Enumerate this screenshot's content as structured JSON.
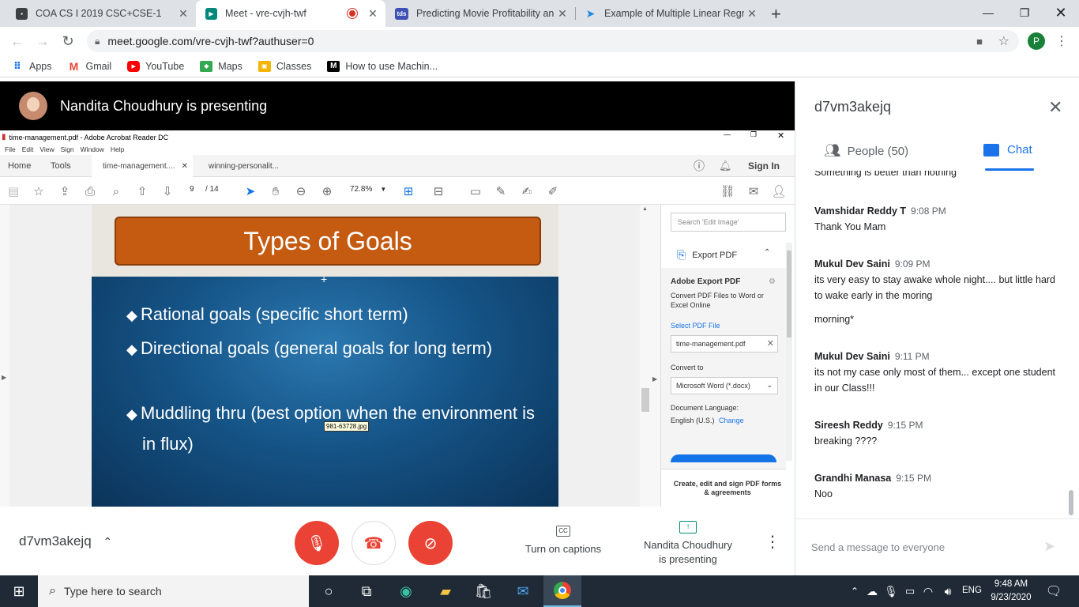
{
  "browser": {
    "tabs": [
      {
        "title": "COA CS I 2019 CSC+CSE-1",
        "color": "#202124"
      },
      {
        "title": "Meet - vre-cvjh-twf",
        "color": "#00897b"
      },
      {
        "title": "Predicting Movie Profitability and",
        "color": "#3f51b5"
      },
      {
        "title": "Example of Multiple Linear Regre",
        "color": "#1e88e5"
      }
    ],
    "tab_favicon_text": "tds",
    "new_tab": "+",
    "url": "meet.google.com/vre-cvjh-twf?authuser=0",
    "profile_initial": "P",
    "bookmarks": [
      "Apps",
      "Gmail",
      "YouTube",
      "Maps",
      "Classes",
      "How to use Machin..."
    ]
  },
  "meet": {
    "presenter_banner": "Nandita Choudhury is presenting",
    "meeting_code": "d7vm3akejq",
    "captions_label": "Turn on captions",
    "presenting_label_line1": "Nandita Choudhury",
    "presenting_label_line2": "is presenting",
    "panel_title": "d7vm3akejq",
    "people_tab": "People (50)",
    "chat_tab": "Chat",
    "partial_top_message": "Something is better than nothing",
    "messages": [
      {
        "sender": "Vamshidar Reddy T",
        "time": "9:08 PM",
        "lines": [
          "Thank You Mam"
        ]
      },
      {
        "sender": "Mukul Dev Saini",
        "time": "9:09 PM",
        "lines": [
          "its very easy to stay awake whole night.... but little hard to wake early in the moring",
          "morning*"
        ]
      },
      {
        "sender": "Mukul Dev Saini",
        "time": "9:11 PM",
        "lines": [
          "its not my case only most of them... except one student in our Class!!!"
        ]
      },
      {
        "sender": "Sireesh Reddy",
        "time": "9:15 PM",
        "lines": [
          "breaking ????"
        ]
      },
      {
        "sender": "Grandhi Manasa",
        "time": "9:15 PM",
        "lines": [
          "Noo"
        ]
      }
    ],
    "chat_placeholder": "Send a message to everyone"
  },
  "acrobat": {
    "window_title": "time-management.pdf - Adobe Acrobat Reader DC",
    "menu": [
      "File",
      "Edit",
      "View",
      "Sign",
      "Window",
      "Help"
    ],
    "tabs": [
      "Home",
      "Tools",
      "time-management....",
      "winning-personalit..."
    ],
    "sign_in": "Sign In",
    "page_current": "9",
    "page_total": "/ 14",
    "zoom": "72.8%",
    "slide": {
      "title": "Types of Goals",
      "bullets": [
        "Rational goals (specific short term)",
        "Directional goals (general goals for long term)",
        "Muddling thru (best option when the environment is in flux)"
      ],
      "tooltip": "981-63728.jpg"
    },
    "right_panel": {
      "search_placeholder": "Search 'Edit Image'",
      "export_pdf": "Export PDF",
      "heading": "Adobe Export PDF",
      "desc": "Convert PDF Files to Word or Excel Online",
      "select_file": "Select PDF File",
      "file_name": "time-management.pdf",
      "convert_to": "Convert to",
      "format": "Microsoft Word (*.docx)",
      "doc_lang_label": "Document Language:",
      "doc_lang": "English (U.S.)",
      "change": "Change",
      "footer": "Create, edit and sign PDF forms & agreements"
    }
  },
  "taskbar": {
    "search_placeholder": "Type here to search",
    "language": "ENG",
    "time": "9:48 AM",
    "date": "9/23/2020"
  },
  "colors": {
    "meet_red": "#ea4335",
    "google_blue": "#1a73e8",
    "slide_title_bg": "#c55a11"
  }
}
